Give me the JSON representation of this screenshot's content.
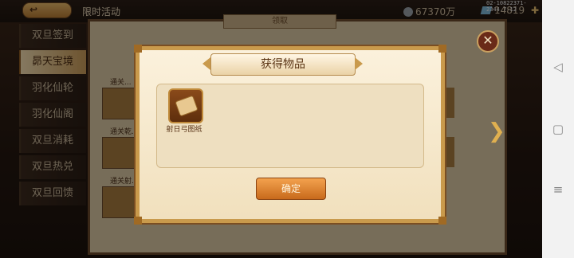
{
  "topbar": {
    "title": "限时活动",
    "coins": "67370万",
    "gems": "14819",
    "debug_id": "02-10822371-2344.7-12"
  },
  "sidebar": {
    "items": [
      {
        "label": "双旦签到",
        "active": false
      },
      {
        "label": "昴天宝境",
        "active": true
      },
      {
        "label": "羽化仙轮",
        "active": false
      },
      {
        "label": "羽化仙阁",
        "active": false
      },
      {
        "label": "双旦消耗",
        "active": false
      },
      {
        "label": "双旦热兑",
        "active": false
      },
      {
        "label": "双旦回馈",
        "active": false
      }
    ]
  },
  "background_panel": {
    "tab_label": "领取",
    "row_labels": [
      "通关...",
      "通关乾...",
      "通关射..."
    ]
  },
  "modal": {
    "title": "获得物品",
    "items": [
      {
        "name": "射日弓图纸",
        "icon": "scroll-icon"
      }
    ],
    "confirm_label": "确定"
  },
  "colors": {
    "modal_bg": "#f6e8cb",
    "button_orange": "#e08634",
    "frame_gold": "#c99a4c"
  }
}
